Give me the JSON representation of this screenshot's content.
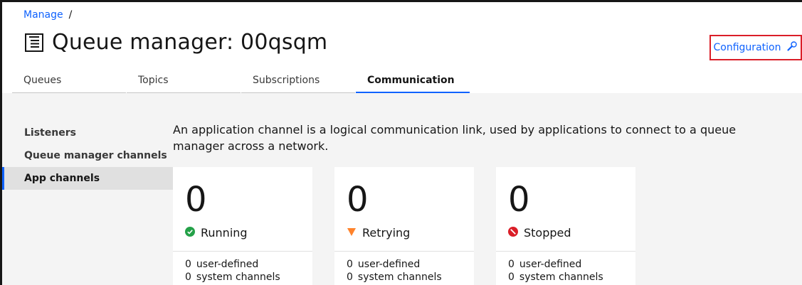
{
  "breadcrumb": {
    "link": "Manage",
    "separator": "/"
  },
  "page": {
    "title": "Queue manager: 00qsqm"
  },
  "config_button": {
    "label": "Configuration",
    "icon": "wrench-icon"
  },
  "tabs": [
    {
      "label": "Queues"
    },
    {
      "label": "Topics"
    },
    {
      "label": "Subscriptions"
    },
    {
      "label": "Communication",
      "active": true
    }
  ],
  "sidenav": {
    "items": [
      {
        "label": "Listeners"
      },
      {
        "label": "Queue manager channels"
      },
      {
        "label": "App channels",
        "active": true
      }
    ]
  },
  "description": "An application channel is a logical communication link, used by applications to connect to a queue manager across a network.",
  "cards": [
    {
      "count": "0",
      "status": "Running",
      "status_icon": "check-circle-icon",
      "status_color": "#24a148",
      "user_defined_count": "0",
      "user_defined_label": "user-defined",
      "system_count": "0",
      "system_label": "system channels"
    },
    {
      "count": "0",
      "status": "Retrying",
      "status_icon": "warning-triangle-icon",
      "status_color": "#ff832b",
      "user_defined_count": "0",
      "user_defined_label": "user-defined",
      "system_count": "0",
      "system_label": "system channels"
    },
    {
      "count": "0",
      "status": "Stopped",
      "status_icon": "stop-circle-icon",
      "status_color": "#da1e28",
      "user_defined_count": "0",
      "user_defined_label": "user-defined",
      "system_count": "0",
      "system_label": "system channels"
    }
  ],
  "colors": {
    "accent": "#0f62fe",
    "highlight_border": "#da1e28",
    "panel_bg": "#f4f4f4"
  }
}
